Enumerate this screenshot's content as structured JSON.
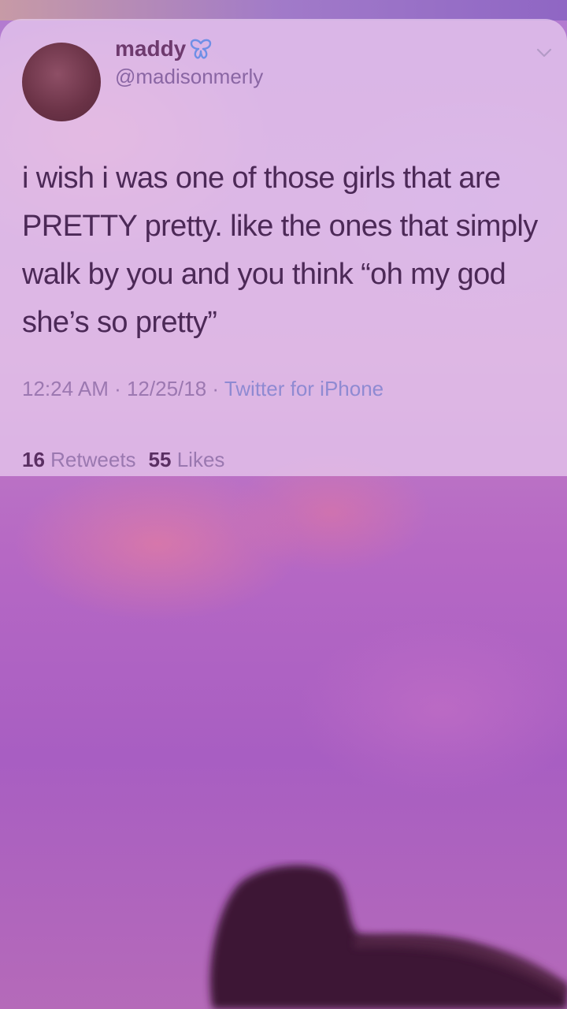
{
  "tweet": {
    "display_name": "maddy",
    "handle": "@madisonmerly",
    "text": "i wish i was one of those girls that are PRETTY pretty. like the ones that simply walk by you and you think “oh my god she’s so pretty”",
    "time": "12:24 AM",
    "separator": " · ",
    "date": "12/25/18",
    "source": "Twitter for iPhone",
    "retweets_count": "16",
    "retweets_label": "Retweets",
    "likes_count": "55",
    "likes_label": "Likes"
  },
  "icons": {
    "name_badge": "butterfly-icon",
    "menu": "chevron-down-icon"
  },
  "colors": {
    "card_tint": "#e9cdf0",
    "text": "#4c2957",
    "meta": "#9c78b1",
    "background": "#b27bd1"
  }
}
